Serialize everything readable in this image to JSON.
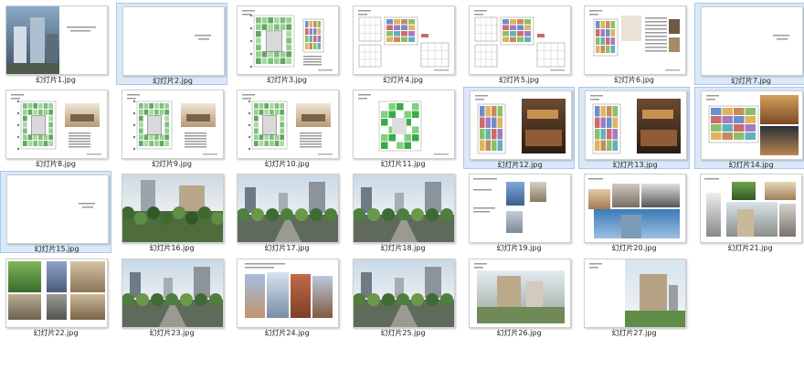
{
  "files": [
    {
      "name": "幻灯片1.jpg",
      "kind": "photo-title",
      "selected": false
    },
    {
      "name": "幻灯片2.jpg",
      "kind": "blank",
      "selected": true
    },
    {
      "name": "幻灯片3.jpg",
      "kind": "plan-green",
      "selected": false
    },
    {
      "name": "幻灯片4.jpg",
      "kind": "plan-color",
      "selected": false
    },
    {
      "name": "幻灯片5.jpg",
      "kind": "plan-color",
      "selected": false
    },
    {
      "name": "幻灯片6.jpg",
      "kind": "plan-text",
      "selected": false
    },
    {
      "name": "幻灯片7.jpg",
      "kind": "blank",
      "selected": true
    },
    {
      "name": "幻灯片8.jpg",
      "kind": "plan-green-photo",
      "selected": false
    },
    {
      "name": "幻灯片9.jpg",
      "kind": "plan-green-photo",
      "selected": false
    },
    {
      "name": "幻灯片10.jpg",
      "kind": "plan-green-photo",
      "selected": false
    },
    {
      "name": "幻灯片11.jpg",
      "kind": "plan-green2",
      "selected": false
    },
    {
      "name": "幻灯片12.jpg",
      "kind": "plan-photo",
      "selected": true
    },
    {
      "name": "幻灯片13.jpg",
      "kind": "plan-photo",
      "selected": true
    },
    {
      "name": "幻灯片14.jpg",
      "kind": "plan-photo2",
      "selected": true
    },
    {
      "name": "幻灯片15.jpg",
      "kind": "blank",
      "selected": true
    },
    {
      "name": "幻灯片16.jpg",
      "kind": "render-trees",
      "selected": false
    },
    {
      "name": "幻灯片17.jpg",
      "kind": "render-street",
      "selected": false
    },
    {
      "name": "幻灯片18.jpg",
      "kind": "render-street",
      "selected": false
    },
    {
      "name": "幻灯片19.jpg",
      "kind": "small-photos",
      "selected": false
    },
    {
      "name": "幻灯片20.jpg",
      "kind": "photos-sky",
      "selected": false
    },
    {
      "name": "幻灯片21.jpg",
      "kind": "photos-mixed",
      "selected": false
    },
    {
      "name": "幻灯片22.jpg",
      "kind": "materials",
      "selected": false
    },
    {
      "name": "幻灯片23.jpg",
      "kind": "render-street",
      "selected": false
    },
    {
      "name": "幻灯片24.jpg",
      "kind": "buildings-row",
      "selected": false
    },
    {
      "name": "幻灯片25.jpg",
      "kind": "render-street",
      "selected": false
    },
    {
      "name": "幻灯片26.jpg",
      "kind": "render-building",
      "selected": false
    },
    {
      "name": "幻灯片27.jpg",
      "kind": "render-building2",
      "selected": false
    }
  ],
  "colors": {
    "selection": "#dbe8f8",
    "selection_border": "#a9c7ee"
  }
}
